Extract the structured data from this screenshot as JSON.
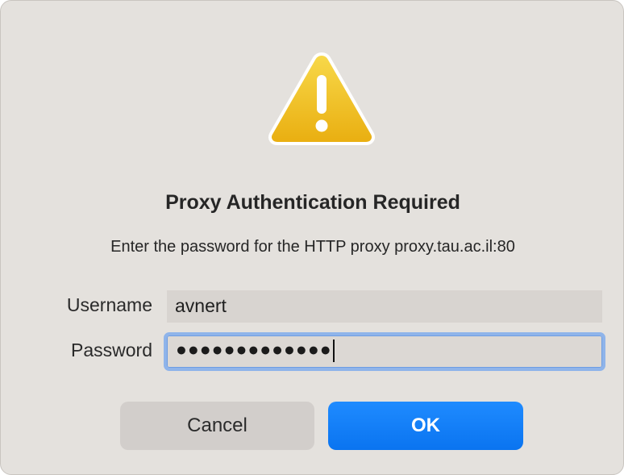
{
  "dialog": {
    "icon": "warning-triangle-icon",
    "title": "Proxy Authentication Required",
    "message": "Enter the password for the HTTP proxy proxy.tau.ac.il:80"
  },
  "form": {
    "username_label": "Username",
    "username_value": "avnert",
    "password_label": "Password",
    "password_masked": "●●●●●●●●●●●●●"
  },
  "buttons": {
    "cancel_label": "Cancel",
    "ok_label": "OK"
  },
  "colors": {
    "dialog_bg": "#e4e1dd",
    "accent_blue": "#0a74f0",
    "warning_yellow": "#f2c21b",
    "focus_ring": "#8fb4ea"
  }
}
